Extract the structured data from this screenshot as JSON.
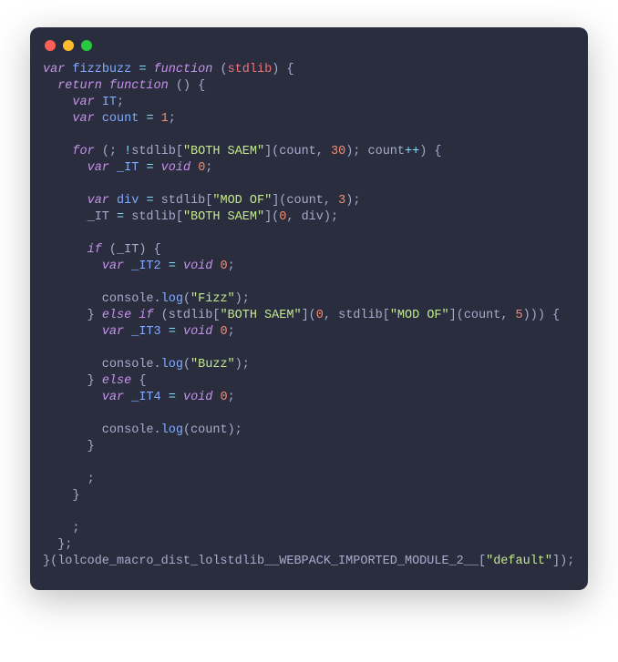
{
  "window": {
    "dots": {
      "red": "#ff5f56",
      "yellow": "#ffbd2e",
      "green": "#27c93f"
    }
  },
  "code": {
    "kw_var": "var",
    "kw_function": "function",
    "kw_return": "return",
    "kw_for": "for",
    "kw_if": "if",
    "kw_else": "else",
    "kw_void": "void",
    "fizzbuzz": "fizzbuzz",
    "stdlib": "stdlib",
    "IT": "IT",
    "count": "count",
    "_IT": "_IT",
    "_IT2": "_IT2",
    "_IT3": "_IT3",
    "_IT4": "_IT4",
    "div": "div",
    "console": "console",
    "log": "log",
    "BOTH_SAEM": "\"BOTH SAEM\"",
    "MOD_OF": "\"MOD OF\"",
    "Fizz": "\"Fizz\"",
    "Buzz": "\"Buzz\"",
    "num0": "0",
    "num1": "1",
    "num3": "3",
    "num5": "5",
    "num30": "30",
    "webpack": "lolcode_macro_dist_lolstdlib__WEBPACK_IMPORTED_MODULE_2__",
    "default": "\"default\""
  }
}
